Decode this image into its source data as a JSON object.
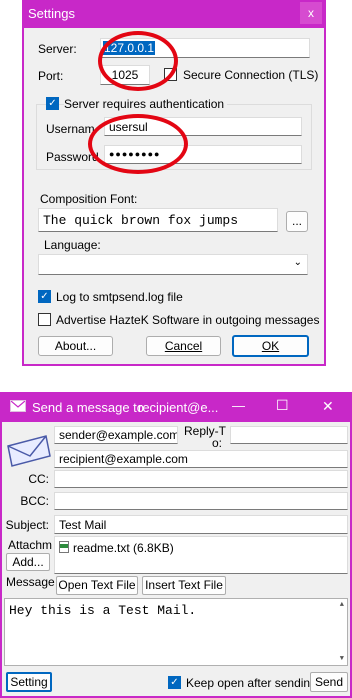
{
  "settings": {
    "title": "Settings",
    "close_glyph": "x",
    "server_label": "Server:",
    "server_value": "127.0.0.1",
    "port_label": "Port:",
    "port_value": "1025",
    "secure_label": "Secure Connection (TLS)",
    "secure_checked": false,
    "auth_label": "Server requires authentication",
    "auth_checked": true,
    "username_label": "Usernam",
    "username_value": "usersul",
    "password_label": "Password",
    "password_value": "●●●●●●●●",
    "composition_font_label": "Composition Font:",
    "font_sample": "The quick brown fox jumps",
    "font_browse_label": "...",
    "language_label": "Language:",
    "language_value": "",
    "log_label": "Log to smtpsend.log file",
    "log_checked": true,
    "advertise_label": "Advertise HazteK Software in outgoing messages",
    "advertise_checked": false,
    "about_label": "About...",
    "cancel_label": "Cancel",
    "ok_label": "OK"
  },
  "send": {
    "title_prefix": "Send a message to",
    "title_recipient": "recipient@e...",
    "from_value": "sender@example.com",
    "reply_to_label_1": "Reply-T",
    "reply_to_label_2": "o:",
    "reply_to_value": "",
    "to_value": "recipient@example.com",
    "cc_label": "CC:",
    "cc_value": "",
    "bcc_label": "BCC:",
    "bcc_value": "",
    "subject_label": "Subject:",
    "subject_value": "Test Mail",
    "attach_label": "Attachm",
    "add_label": "Add...",
    "attachment_name": "readme.txt (6.8KB)",
    "message_label": "Message",
    "open_text_label": "Open Text File",
    "insert_text_label": "Insert Text File",
    "message_body": "Hey this is a Test Mail.",
    "setting_label": "Setting",
    "keep_open_label": "Keep open after sending",
    "keep_open_checked": true,
    "send_label": "Send",
    "minimize_glyph": "—",
    "maximize_glyph": "☐",
    "close_glyph": "✕"
  },
  "colors": {
    "accent": "#c828c8",
    "annotation": "#e30613",
    "selection": "#0067c0"
  }
}
